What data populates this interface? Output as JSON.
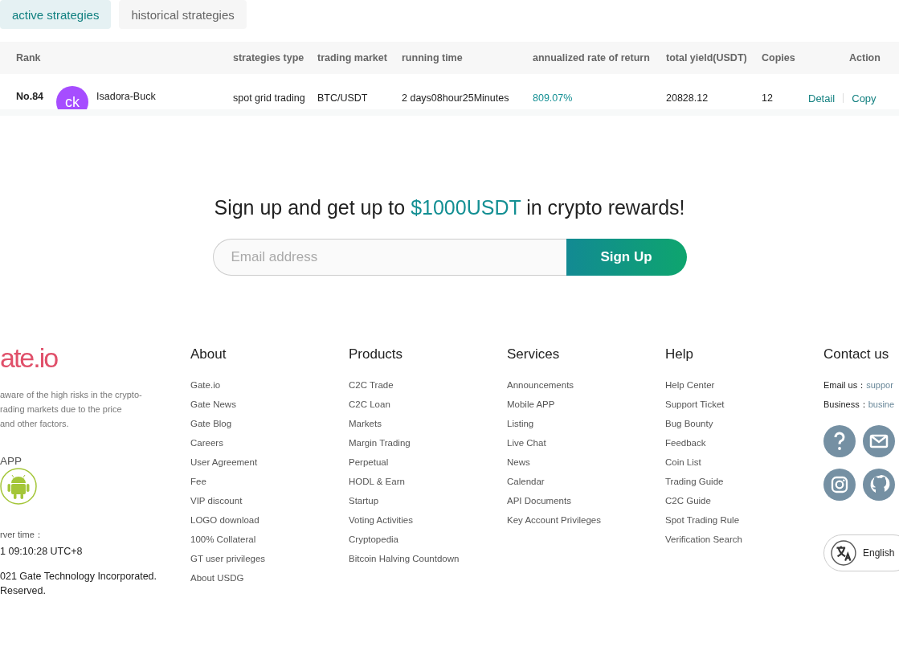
{
  "tabs": [
    {
      "label": "active strategies",
      "selected": true
    },
    {
      "label": "historical strategies",
      "selected": false
    }
  ],
  "table": {
    "columns": [
      "Rank",
      "strategies type",
      "trading market",
      "running time",
      "annualized rate of return",
      "total yield(USDT)",
      "Copies",
      "Action"
    ],
    "rows": [
      {
        "rank": "No.84",
        "avatar": "ck",
        "name": "Isadora-Buck",
        "type": "spot grid trading",
        "market": "BTC/USDT",
        "running_time": "2 days08hour25Minutes",
        "return": "809.07%",
        "yield": "20828.12",
        "copies": "12",
        "actions": [
          "Detail",
          "Copy"
        ]
      }
    ]
  },
  "signup": {
    "title_before": "Sign up and get up to ",
    "title_highlight": "$1000USDT",
    "title_after": " in crypto rewards!",
    "placeholder": "Email address",
    "button": "Sign Up"
  },
  "footer": {
    "logo": "ate.io",
    "disclaimer": [
      "aware of the high risks in the crypto-",
      "rading markets due to the price",
      "and other factors."
    ],
    "app_label": "APP",
    "server_time_label": "rver time：",
    "server_time": "1 09:10:28 UTC+8",
    "copyright": [
      "021 Gate Technology Incorporated.",
      "Reserved."
    ],
    "columns": [
      {
        "title": "About",
        "links": [
          "Gate.io",
          "Gate News",
          "Gate Blog",
          "Careers",
          "User Agreement",
          "Fee",
          "VIP discount",
          "LOGO download",
          "100% Collateral",
          "GT user privileges",
          "About USDG"
        ]
      },
      {
        "title": "Products",
        "links": [
          "C2C Trade",
          "C2C Loan",
          "Markets",
          "Margin Trading",
          "Perpetual",
          "HODL & Earn",
          "Startup",
          "Voting Activities",
          "Cryptopedia",
          "Bitcoin Halving Countdown"
        ]
      },
      {
        "title": "Services",
        "links": [
          "Announcements",
          "Mobile APP",
          "Listing",
          "Live Chat",
          "News",
          "Calendar",
          "API Documents",
          "Key Account Privileges"
        ]
      },
      {
        "title": "Help",
        "links": [
          "Help Center",
          "Support Ticket",
          "Bug Bounty",
          "Feedback",
          "Coin List",
          "Trading Guide",
          "C2C Guide",
          "Spot Trading Rule",
          "Verification Search"
        ]
      }
    ],
    "contact": {
      "title": "Contact us",
      "lines": [
        {
          "label": "Email us：",
          "value": "suppor"
        },
        {
          "label": "Business：",
          "value": "busine"
        }
      ],
      "language": "English"
    }
  }
}
